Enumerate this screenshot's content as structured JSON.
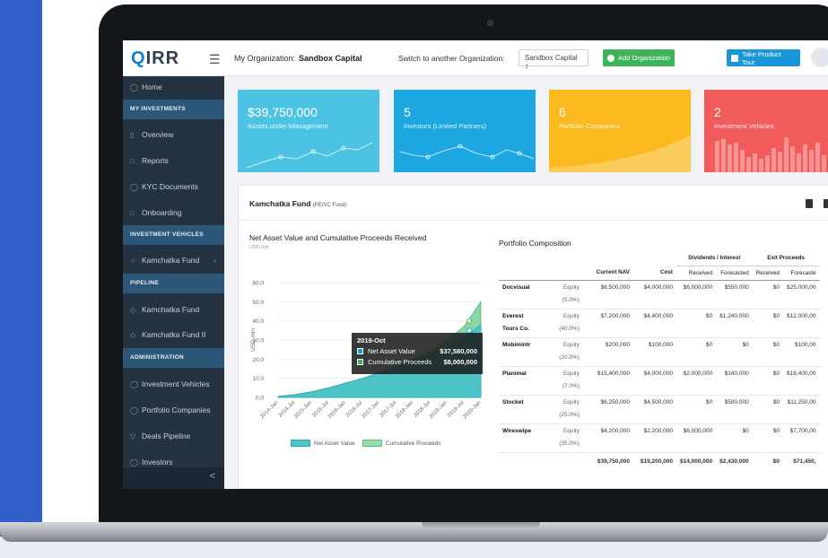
{
  "topbar": {
    "logo_prefix": "Q",
    "logo_text": "IRR",
    "org_label": "My Organization:",
    "org_name": "Sandbox Capital",
    "switch_label": "Switch to another Organization:",
    "org_select": "Sandbox Capital ↕",
    "add_org": "Add Organization",
    "tour": "Take Product Tour"
  },
  "sidebar": {
    "home": "Home",
    "my_investments_header": "MY INVESTMENTS",
    "overview": "Overview",
    "reports": "Reports",
    "kyc": "KYC Documents",
    "onboarding": "Onboarding",
    "vehicles_header": "INVESTMENT VEHICLES",
    "kamchatka_fund": "Kamchatka Fund",
    "pipeline_header": "PIPELINE",
    "pipeline_fund1": "Kamchatka Fund",
    "pipeline_fund2": "Kamchatka Fund II",
    "admin_header": "ADMINISTRATION",
    "admin_vehicles": "Investment Vehicles",
    "admin_portfolio": "Portfolio Companies",
    "admin_deals": "Deals Pipeline",
    "admin_investors": "Investors",
    "collapse": "<"
  },
  "cards": [
    {
      "value": "$39,750,000",
      "label": "Assets under Management",
      "color": "#4dc3e3"
    },
    {
      "value": "5",
      "label": "Investors (Limited Partners)",
      "color": "#1da7e0"
    },
    {
      "value": "6",
      "label": "Portfolio Companies",
      "color": "#fbb91d"
    },
    {
      "value": "2",
      "label": "Investment Vehicles",
      "color": "#f25b5b"
    }
  ],
  "panel": {
    "fund_name": "Kamchatka Fund",
    "fund_type": "(PE/VC Fund)"
  },
  "chart": {
    "title": "Net Asset Value and Cumulative Proceeds Received",
    "unit": "USD mln",
    "y_axis_label": "USD mln",
    "tooltip_title": "2019-Oct",
    "tooltip_nav_label": "Net Asset Value",
    "tooltip_nav_value": "$37,580,000",
    "tooltip_cp_label": "Cumulative Proceeds",
    "tooltip_cp_value": "$8,000,000",
    "legend_nav": "Net Asset Value",
    "legend_cp": "Cumulative Proceeds"
  },
  "chart_data": {
    "type": "area",
    "title": "Net Asset Value and Cumulative Proceeds Received",
    "ylabel": "USD mln",
    "ylim": [
      0,
      60
    ],
    "yticks": [
      "0.0",
      "10.0",
      "20.0",
      "30.0",
      "40.0",
      "50.0",
      "60.0"
    ],
    "categories": [
      "2014-Jan",
      "2014-Jul",
      "2015-Jan",
      "2015-Jul",
      "2016-Jan",
      "2016-Jul",
      "2017-Jan",
      "2017-Jul",
      "2018-Jan",
      "2018-Jul",
      "2019-Jan",
      "2019-Jul",
      "2020-Jan"
    ],
    "series": [
      {
        "name": "Net Asset Value",
        "color": "#4ec3c7",
        "values": [
          0.5,
          1.5,
          3,
          5,
          7.5,
          10,
          13,
          16,
          19,
          22,
          26,
          31,
          38
        ]
      },
      {
        "name": "Cumulative Proceeds",
        "color": "#7fd39a",
        "values": [
          0.5,
          1.5,
          3,
          5,
          7.5,
          10,
          13,
          16,
          20,
          24,
          30,
          37,
          50
        ]
      }
    ],
    "legend": "bottom",
    "grid": true
  },
  "portfolio": {
    "title": "Portfolio Composition",
    "group_dividends": "Dividends / Interest",
    "group_exit": "Exit Proceeds",
    "col_nav": "Current NAV",
    "col_cost": "Cost",
    "col_received": "Received",
    "col_forecasted": "Forecasted",
    "col_received2": "Received",
    "col_forecasted2": "Forecaste",
    "rows": [
      {
        "name": "Docvisual",
        "name2": "",
        "type": "Equity",
        "pct": "(5.0%)",
        "nav": "$6,500,000",
        "cost": "$4,000,000",
        "div_rec": "$6,000,000",
        "div_fc": "$550,000",
        "exit_rec": "$0",
        "exit_fc": "$25,000,00"
      },
      {
        "name": "Everest",
        "name2": "Tours Co.",
        "type": "Equity",
        "pct": "(40.0%)",
        "nav": "$7,200,000",
        "cost": "$4,400,000",
        "div_rec": "$0",
        "div_fc": "$1,240,000",
        "exit_rec": "$0",
        "exit_fc": "$12,000,00"
      },
      {
        "name": "Mobimintr",
        "name2": "",
        "type": "Equity",
        "pct": "(20.0%)",
        "nav": "$200,000",
        "cost": "$100,000",
        "div_rec": "$0",
        "div_fc": "$0",
        "exit_rec": "$0",
        "exit_fc": "$100,00"
      },
      {
        "name": "Planimal",
        "name2": "",
        "type": "Equity",
        "pct": "(7.0%)",
        "nav": "$15,400,000",
        "cost": "$4,000,000",
        "div_rec": "$2,000,000",
        "div_fc": "$140,000",
        "exit_rec": "$0",
        "exit_fc": "$18,400,00"
      },
      {
        "name": "Stocket",
        "name2": "",
        "type": "Equity",
        "pct": "(25.0%)",
        "nav": "$6,250,000",
        "cost": "$4,500,000",
        "div_rec": "$0",
        "div_fc": "$500,000",
        "exit_rec": "$0",
        "exit_fc": "$11,250,00"
      },
      {
        "name": "Wireswipe",
        "name2": "",
        "type": "Equity",
        "pct": "(35.0%)",
        "nav": "$4,200,000",
        "cost": "$2,200,000",
        "div_rec": "$6,000,000",
        "div_fc": "$0",
        "exit_rec": "$0",
        "exit_fc": "$7,700,00"
      }
    ],
    "total": {
      "nav": "$39,750,000",
      "cost": "$19,200,000",
      "div_rec": "$14,000,000",
      "div_fc": "$2,430,000",
      "exit_rec": "$0",
      "exit_fc": "$71,450,"
    }
  }
}
